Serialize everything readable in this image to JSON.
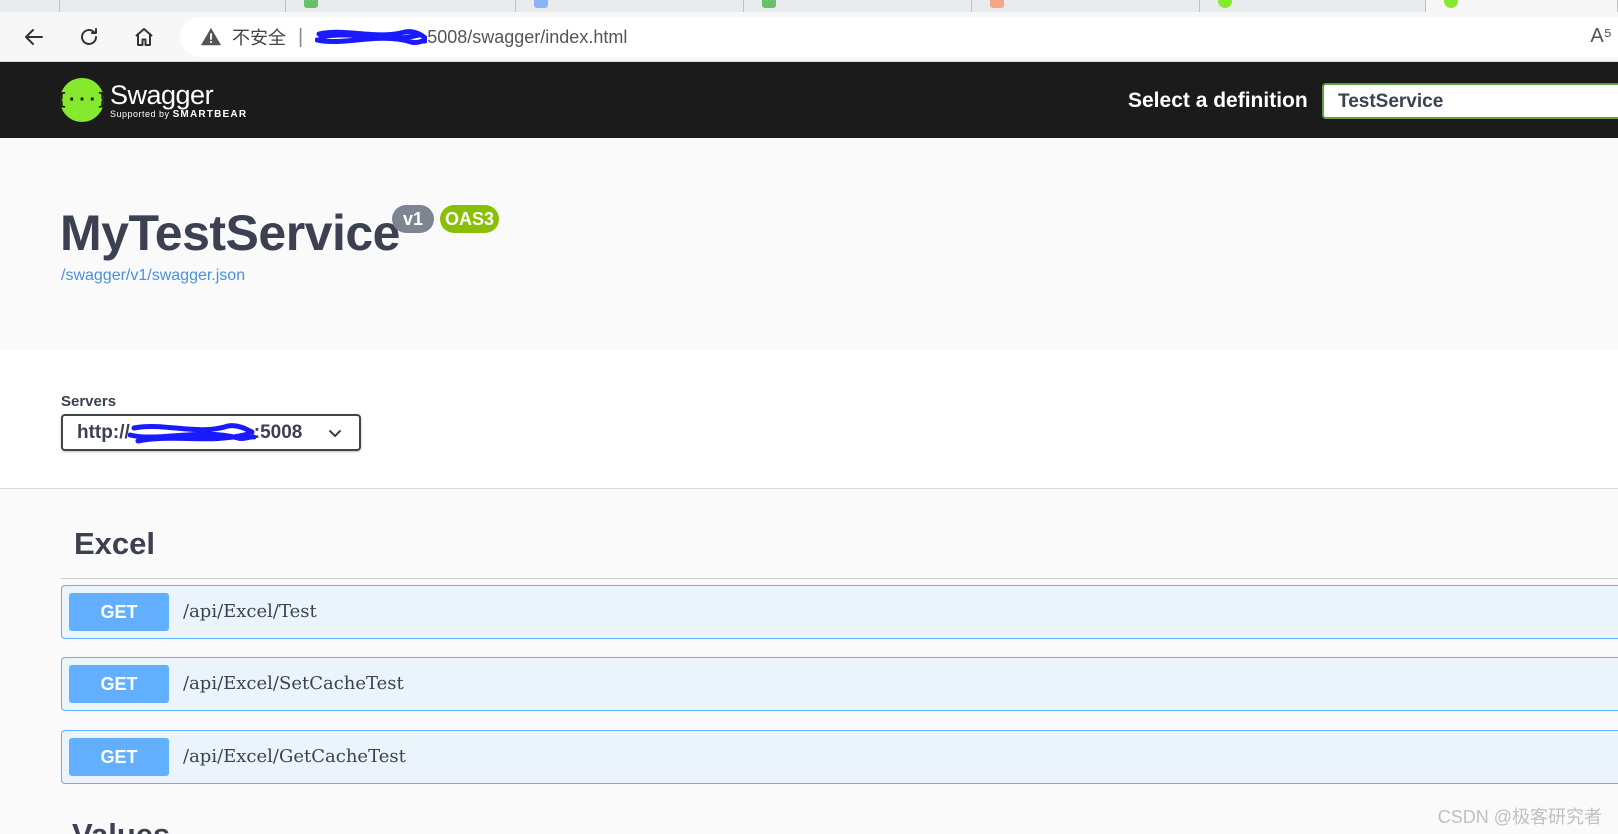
{
  "browser": {
    "security_label": "不安全",
    "separator": "|",
    "url_visible": "5008/swagger/index.html",
    "reader_icon_glyph": "A⁵"
  },
  "swagger": {
    "brand": "Swagger",
    "supported_by": "Supported by",
    "smartbear": "SMARTBEAR",
    "logo_glyph": "{···}",
    "definition_label": "Select a definition",
    "definition_selected": "TestService"
  },
  "info": {
    "title": "MyTestService",
    "version_badge": "v1",
    "oas_badge": "OAS3",
    "spec_link": "/swagger/v1/swagger.json"
  },
  "servers": {
    "label": "Servers",
    "selected_prefix": "http://",
    "selected_suffix": ":5008"
  },
  "tags": [
    {
      "name": "Excel",
      "operations": [
        {
          "method": "GET",
          "path": "/api/Excel/Test"
        },
        {
          "method": "GET",
          "path": "/api/Excel/SetCacheTest"
        },
        {
          "method": "GET",
          "path": "/api/Excel/GetCacheTest"
        }
      ]
    },
    {
      "name": "Values",
      "operations": []
    }
  ],
  "watermark": "CSDN @极客研究者",
  "colors": {
    "topbar": "#1b1b1b",
    "get_method": "#61affe",
    "get_bg": "#ebf3fb",
    "oas_badge": "#89bf04",
    "version_badge": "#7d8492",
    "logo_green": "#85ea2d",
    "link": "#4990e2"
  }
}
